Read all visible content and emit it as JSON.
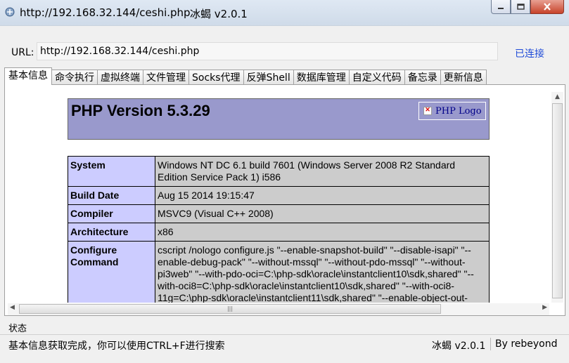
{
  "window": {
    "title_url": "http://192.168.32.144/ceshi.php",
    "title_app": "冰蝎 v2.0.1"
  },
  "urlbar": {
    "label": "URL:",
    "value": "http://192.168.32.144/ceshi.php",
    "status": "已连接"
  },
  "tabs": [
    "基本信息",
    "命令执行",
    "虚拟终端",
    "文件管理",
    "Socks代理",
    "反弹Shell",
    "数据库管理",
    "自定义代码",
    "备忘录",
    "更新信息"
  ],
  "php": {
    "version_title": "PHP Version 5.3.29",
    "logo_alt": "PHP Logo",
    "rows": [
      {
        "key": "System",
        "value": "Windows NT DC 6.1 build 7601 (Windows Server 2008 R2 Standard Edition Service Pack 1) i586"
      },
      {
        "key": "Build Date",
        "value": "Aug 15 2014 19:15:47"
      },
      {
        "key": "Compiler",
        "value": "MSVC9 (Visual C++ 2008)"
      },
      {
        "key": "Architecture",
        "value": "x86"
      },
      {
        "key": "Configure Command",
        "value": "cscript /nologo configure.js \"--enable-snapshot-build\" \"--disable-isapi\" \"--enable-debug-pack\" \"--without-mssql\" \"--without-pdo-mssql\" \"--without-pi3web\" \"--with-pdo-oci=C:\\php-sdk\\oracle\\instantclient10\\sdk,shared\" \"--with-oci8=C:\\php-sdk\\oracle\\instantclient10\\sdk,shared\" \"--with-oci8-11g=C:\\php-sdk\\oracle\\instantclient11\\sdk,shared\" \"--enable-object-out-dir=../obj/\" \"--enable-com-dotnet=shared\" \"--with-mcrypt=static\""
      }
    ]
  },
  "statusbar": {
    "label": "状态",
    "message": "基本信息获取完成，你可以使用CTRL+F进行搜索",
    "version": "冰蝎 v2.0.1",
    "author": "By rebeyond"
  }
}
